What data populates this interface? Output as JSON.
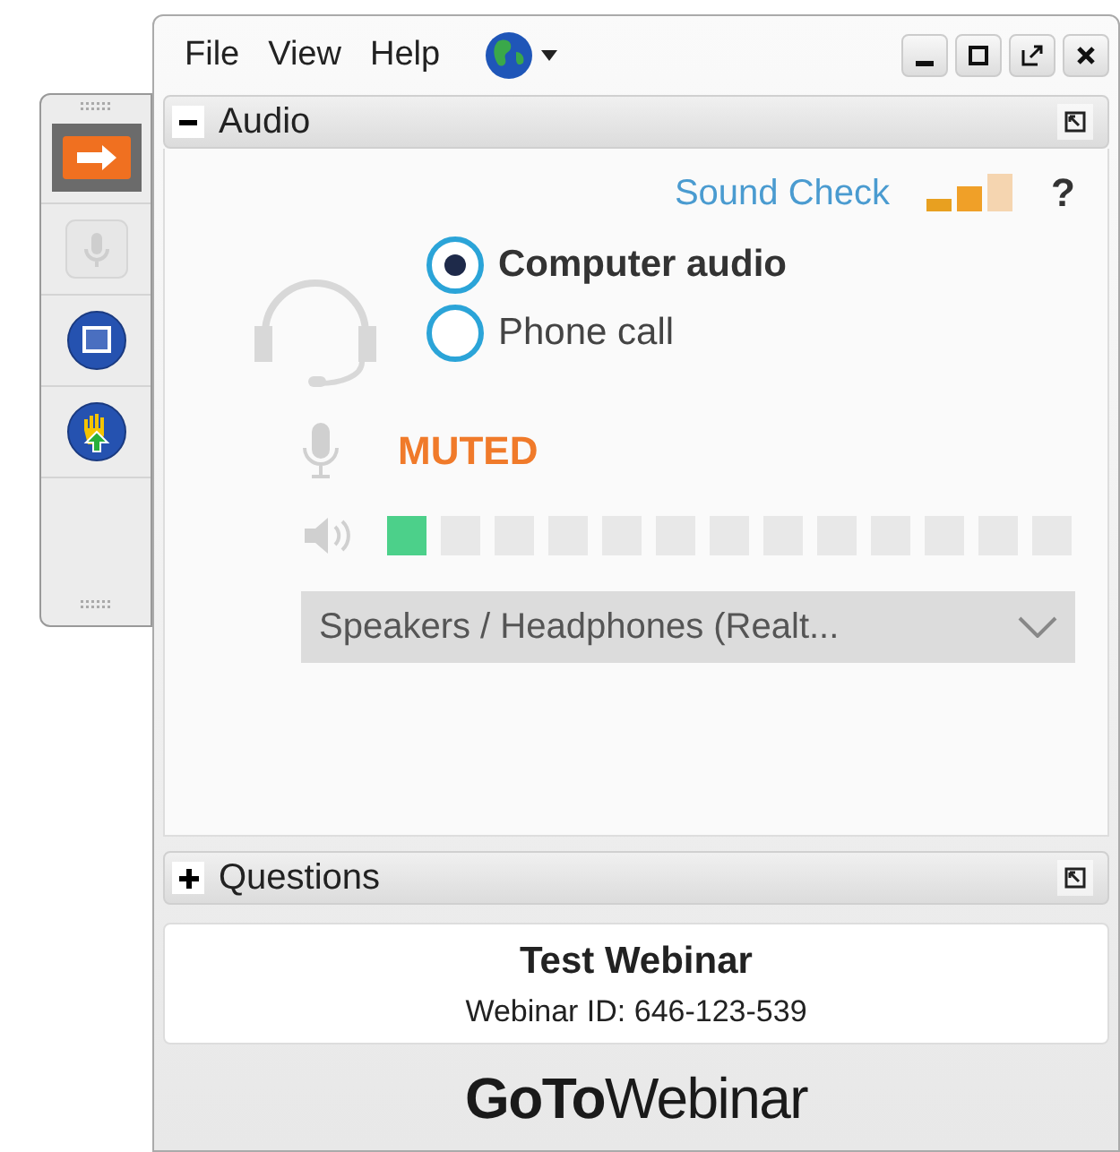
{
  "menu": [
    "File",
    "View",
    "Help"
  ],
  "toolbar": [
    {
      "kind": "arrow",
      "selected": true
    },
    {
      "kind": "mic",
      "disabled": true
    },
    {
      "kind": "screen"
    },
    {
      "kind": "hand"
    }
  ],
  "audio": {
    "title": "Audio",
    "expanded": true,
    "sound_check": "Sound Check",
    "help": "?",
    "options": [
      {
        "label": "Computer audio",
        "selected": true
      },
      {
        "label": "Phone call",
        "selected": false
      }
    ],
    "mic_status": "MUTED",
    "speaker": {
      "level": 0.077
    },
    "device": "Speakers / Headphones (Realt..."
  },
  "questions": {
    "title": "Questions",
    "expanded": false
  },
  "webinar": {
    "title": "Test Webinar",
    "id": "Webinar ID: 646-123-539"
  },
  "logo": "**GoTo**Webinar"
}
